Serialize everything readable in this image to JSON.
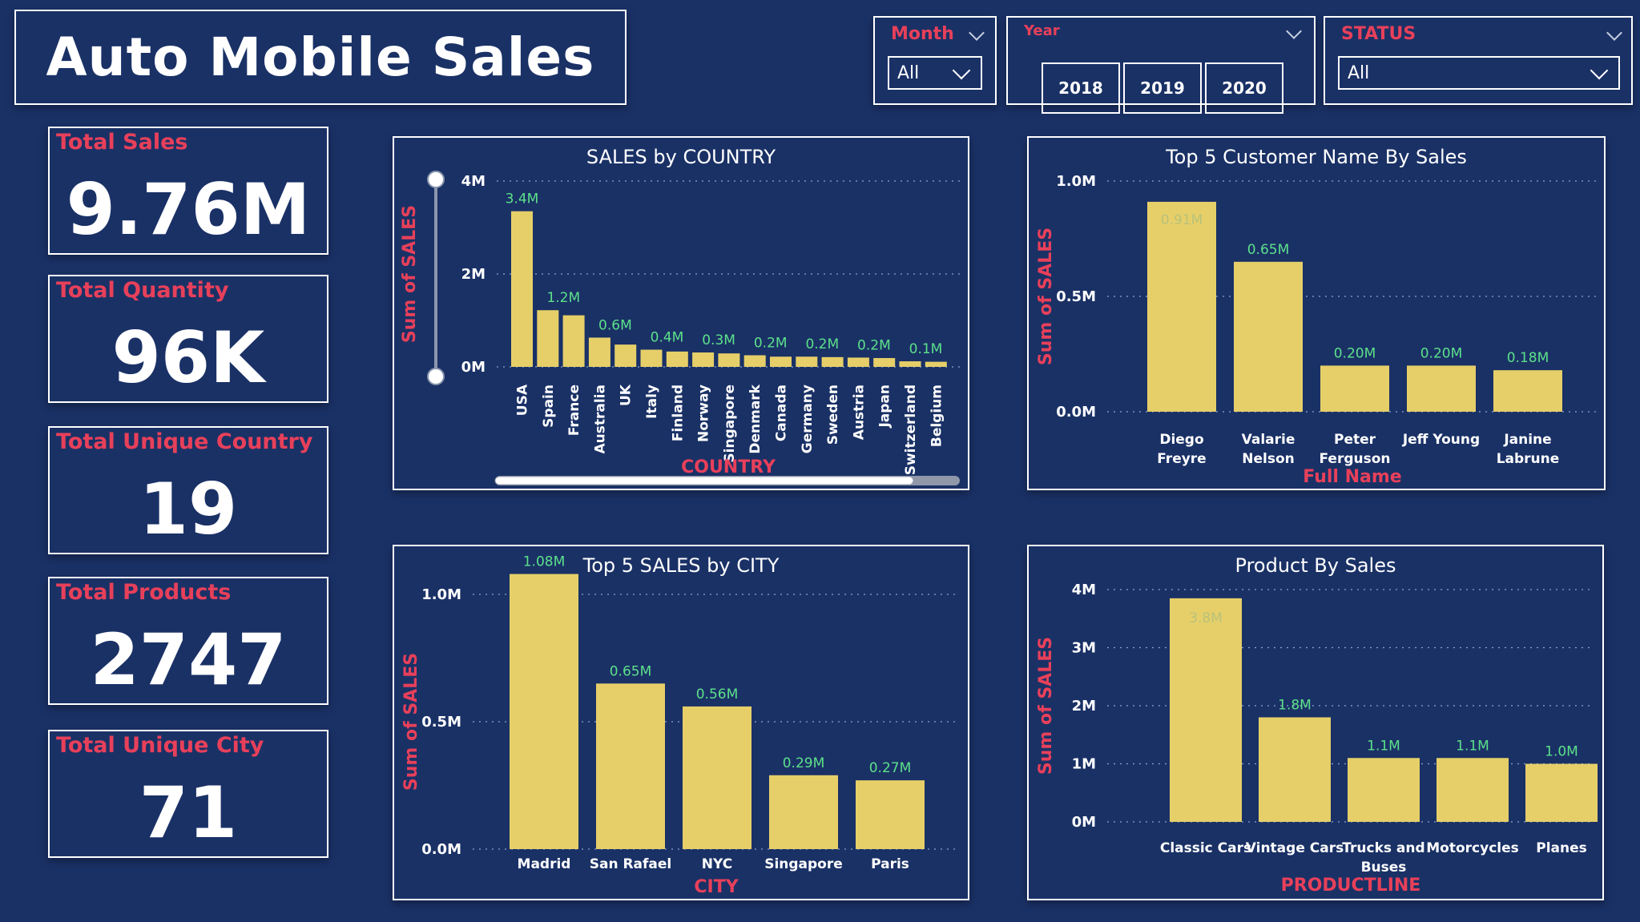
{
  "header": {
    "title": "Auto Mobile Sales"
  },
  "slicers": {
    "month": {
      "label": "Month",
      "value": "All"
    },
    "year": {
      "label": "Year",
      "options": [
        "2018",
        "2019",
        "2020"
      ]
    },
    "status": {
      "label": "STATUS",
      "value": "All"
    }
  },
  "kpis": [
    {
      "label": "Total Sales",
      "value": "9.76M"
    },
    {
      "label": "Total Quantity",
      "value": "96K"
    },
    {
      "label": "Total Unique Country",
      "value": "19"
    },
    {
      "label": "Total Products",
      "value": "2747"
    },
    {
      "label": "Total Unique City",
      "value": "71"
    }
  ],
  "colors": {
    "background": "#1a3166",
    "accent": "#e8405a",
    "bar": "#e6cf69",
    "data_label": "#5ce08a"
  },
  "chart_data": [
    {
      "id": "country",
      "type": "bar",
      "title": "SALES by COUNTRY",
      "xlabel": "COUNTRY",
      "ylabel": "Sum of SALES",
      "ylim": [
        0,
        4
      ],
      "yticks": [
        {
          "value": 0,
          "label": "0M"
        },
        {
          "value": 2,
          "label": "2M"
        },
        {
          "value": 4,
          "label": "4M"
        }
      ],
      "categories": [
        "USA",
        "Spain",
        "France",
        "Australia",
        "UK",
        "Italy",
        "Finland",
        "Norway",
        "Singapore",
        "Denmark",
        "Canada",
        "Germany",
        "Sweden",
        "Austria",
        "Japan",
        "Switzerland",
        "Belgium"
      ],
      "values": [
        3.35,
        1.22,
        1.11,
        0.63,
        0.48,
        0.37,
        0.33,
        0.31,
        0.29,
        0.25,
        0.22,
        0.22,
        0.21,
        0.2,
        0.19,
        0.12,
        0.11
      ],
      "labels": [
        "3.4M",
        "1.2M",
        "",
        "0.6M",
        "",
        "0.4M",
        "",
        "0.3M",
        "",
        "0.2M",
        "",
        "0.2M",
        "",
        "0.2M",
        "",
        "0.1M",
        ""
      ],
      "label_under": [
        "",
        "",
        "0.6M",
        "",
        "0.4M",
        "",
        "0.3M",
        "",
        "0.2M",
        "",
        "0.2M",
        "",
        "0.2M",
        "",
        "0.1M",
        "",
        ""
      ],
      "grid": true
    },
    {
      "id": "customers",
      "type": "bar",
      "title": "Top 5 Customer Name By Sales",
      "xlabel": "Full Name",
      "ylabel": "Sum of SALES",
      "ylim": [
        0,
        1.0
      ],
      "yticks": [
        {
          "value": 0,
          "label": "0.0M"
        },
        {
          "value": 0.5,
          "label": "0.5M"
        },
        {
          "value": 1.0,
          "label": "1.0M"
        }
      ],
      "categories": [
        [
          "Diego",
          "Freyre"
        ],
        [
          "Valarie",
          "Nelson"
        ],
        [
          "Peter",
          "Ferguson"
        ],
        [
          "Jeff Young"
        ],
        [
          "Janine",
          "Labrune"
        ]
      ],
      "values": [
        0.91,
        0.65,
        0.2,
        0.2,
        0.18
      ],
      "labels": [
        "0.91M",
        "0.65M",
        "0.20M",
        "0.20M",
        "0.18M"
      ],
      "grid": true
    },
    {
      "id": "city",
      "type": "bar",
      "title": "Top 5 SALES by CITY",
      "xlabel": "CITY",
      "ylabel": "Sum of SALES",
      "ylim": [
        0,
        1.0
      ],
      "yticks": [
        {
          "value": 0,
          "label": "0.0M"
        },
        {
          "value": 0.5,
          "label": "0.5M"
        },
        {
          "value": 1.0,
          "label": "1.0M"
        }
      ],
      "categories": [
        [
          "Madrid"
        ],
        [
          "San Rafael"
        ],
        [
          "NYC"
        ],
        [
          "Singapore"
        ],
        [
          "Paris"
        ]
      ],
      "values": [
        1.08,
        0.65,
        0.56,
        0.29,
        0.27
      ],
      "labels": [
        "1.08M",
        "0.65M",
        "0.56M",
        "0.29M",
        "0.27M"
      ],
      "grid": true
    },
    {
      "id": "product",
      "type": "bar",
      "title": "Product By Sales",
      "xlabel": "PRODUCTLINE",
      "ylabel": "Sum of SALES",
      "ylim": [
        0,
        4
      ],
      "yticks": [
        {
          "value": 0,
          "label": "0M"
        },
        {
          "value": 1,
          "label": "1M"
        },
        {
          "value": 2,
          "label": "2M"
        },
        {
          "value": 3,
          "label": "3M"
        },
        {
          "value": 4,
          "label": "4M"
        }
      ],
      "categories": [
        [
          "Classic Cars"
        ],
        [
          "Vintage Cars"
        ],
        [
          "Trucks and",
          "Buses"
        ],
        [
          "Motorcycles"
        ],
        [
          "Planes"
        ]
      ],
      "values": [
        3.85,
        1.8,
        1.1,
        1.1,
        1.0
      ],
      "labels": [
        "3.8M",
        "1.8M",
        "1.1M",
        "1.1M",
        "1.0M"
      ],
      "grid": true
    }
  ]
}
